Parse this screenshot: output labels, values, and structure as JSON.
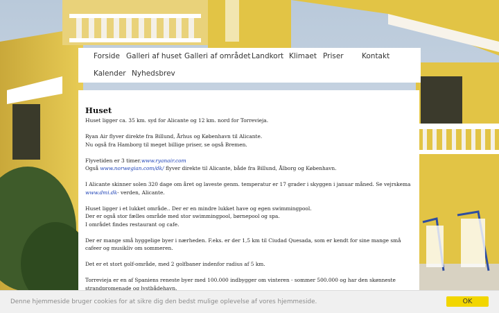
{
  "nav": {
    "items": [
      {
        "label": "Forside"
      },
      {
        "label": "Galleri af huset"
      },
      {
        "label": "Galleri af området"
      },
      {
        "label": "Landkort"
      },
      {
        "label": "Klimaet"
      },
      {
        "label": "Priser"
      },
      {
        "label": "Kontakt"
      },
      {
        "label": "Kalender"
      },
      {
        "label": "Nyhedsbrev"
      }
    ]
  },
  "content": {
    "title": "Huset",
    "p1": "Huset ligger ca. 35 km. syd for Alicante og 12 km. nord for Torrevieja.",
    "p2a": "Ryan Air flyver direkte fra Billund, Århus og København  til Alicante.",
    "p2b": "Nu også fra Hamborg til meget billige priser, se også Bremen.",
    "p3a_text": "Flyvetiden er 3 timer.",
    "p3a_link": "www.ryanair.com",
    "p3b_pre": " Også ",
    "p3b_link": "www.norwegian.com/dk/",
    "p3b_post": "  flyver direkte til Alicante, både fra Billund, Ålborg og København.",
    "p4_text": "I Alicante skinner solen 320 dage om året og laveste genm. temperatur er 17 grader i skyggen i januar måned. Se vejrskema",
    "p4_link": "www.dmi.dk",
    "p4_post": "- verden, Alicante.",
    "p5a": "Huset ligger i et lukket område.. Der er en mindre lukket have og egen swimmingpool.",
    "p5b": "Der er også stor fælles område med stor swimmingpool, børnepool og spa.",
    "p5c": "I området findes restaurant og cafe.",
    "p6": "Der er mange små hyggelige byer i nærheden. F.eks. er der 1,5 km til Ciudad Quesada, som er kendt for sine mange små cafeer og musikliv om sommeren.",
    "p7": "Det er et stort golf-område, med 2 golfbaner indenfor radius af 5 km.",
    "p8": "Torrevieja er en af Spaniens reneste byer med 100.000 indbygger om vinteren - sommer 500.000 og har den skønneste strandpromenade og lystbådehavn."
  },
  "cookie": {
    "message": "Denne hjemmeside bruger cookies for at sikre dig den bedst mulige oplevelse af vores hjemmeside.",
    "ok_label": "OK"
  },
  "colors": {
    "link": "#1a3fb5",
    "cookie_button": "#f2d600",
    "wall": "#e2c445"
  }
}
